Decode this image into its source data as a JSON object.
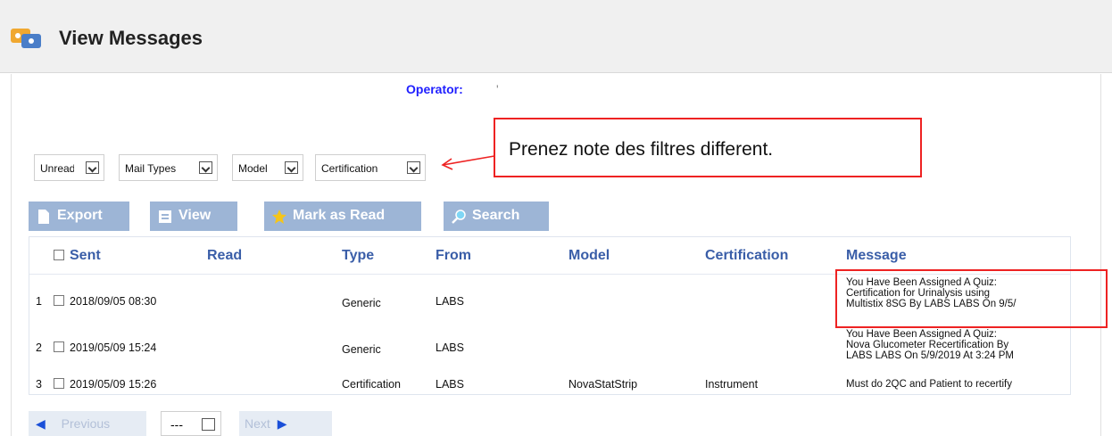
{
  "header": {
    "title": "View Messages",
    "icon": "messages-icon"
  },
  "operator": {
    "label": "Operator:",
    "value": "'"
  },
  "filters": [
    {
      "value": "Unread"
    },
    {
      "value": "Mail Types"
    },
    {
      "value": "Model"
    },
    {
      "value": "Certification"
    }
  ],
  "note": {
    "text": "Prenez note des filtres different."
  },
  "toolbar": {
    "export_label": "Export",
    "view_label": "View",
    "mark_read_label": "Mark as Read",
    "search_label": "Search"
  },
  "table": {
    "columns": [
      "Sent",
      "Read",
      "Type",
      "From",
      "Model",
      "Certification",
      "Message"
    ],
    "rows": [
      {
        "num": "1",
        "sent": "2018/09/05 08:30",
        "read": "",
        "type": "Generic",
        "from": "LABS",
        "model": "",
        "certification": "",
        "message": [
          "You Have Been Assigned A Quiz:",
          "Certification for Urinalysis using",
          "Multistix 8SG By LABS LABS On 9/5/"
        ]
      },
      {
        "num": "2",
        "sent": "2019/05/09 15:24",
        "read": "",
        "type": "Generic",
        "from": "LABS",
        "model": "",
        "certification": "",
        "message": [
          "You Have Been Assigned A Quiz:",
          "Nova Glucometer Recertification By",
          "LABS LABS On 5/9/2019 At 3:24 PM"
        ]
      },
      {
        "num": "3",
        "sent": "2019/05/09 15:26",
        "read": "",
        "type": "Certification",
        "from": "LABS",
        "model": "NovaStatStrip",
        "certification": "Instrument",
        "message": [
          "Must do 2QC and Patient to recertify"
        ]
      }
    ]
  },
  "pager": {
    "previous_label": "Previous",
    "page_value": "---",
    "next_label": "Next"
  },
  "colors": {
    "accent": "#3a5ea8",
    "button": "#9db5d6",
    "highlight": "#e22222",
    "operator": "#2020ff"
  }
}
